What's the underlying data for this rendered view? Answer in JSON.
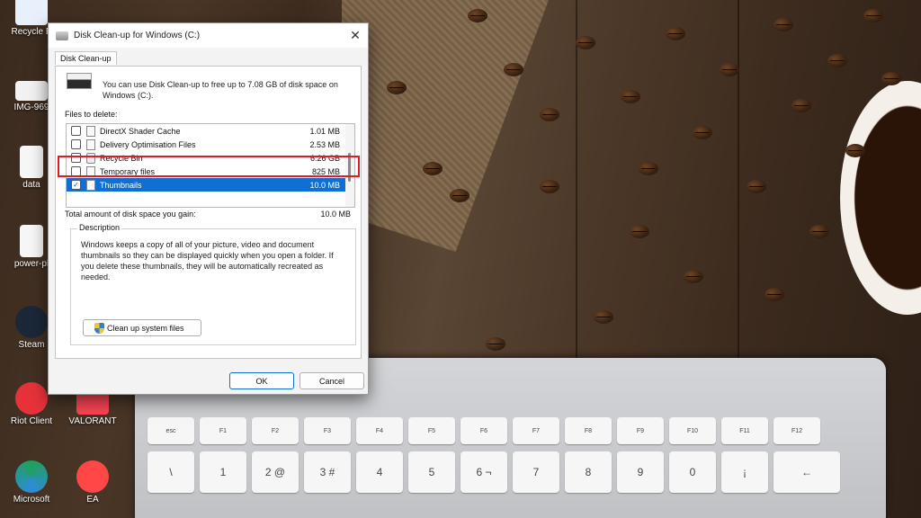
{
  "desktop": {
    "icons": [
      {
        "label": "Recycle B"
      },
      {
        "label": "IMG-969"
      },
      {
        "label": "data"
      },
      {
        "label": "power-pl"
      },
      {
        "label": "Steam"
      },
      {
        "label": "Riot Client"
      },
      {
        "label": "VALORANT"
      },
      {
        "label": "Microsoft"
      },
      {
        "label": "EA"
      }
    ]
  },
  "keyboard": {
    "fn_row": [
      "esc",
      "F1",
      "F2",
      "F3",
      "F4",
      "F5",
      "F6",
      "F7",
      "F8",
      "F9",
      "F10",
      "F11",
      "F12"
    ],
    "num_row": [
      "°",
      "!",
      "\"",
      "·",
      "$",
      "%",
      "&",
      "/",
      "(",
      ")",
      "=",
      "¿"
    ],
    "num_row_lower": [
      "\\",
      "1",
      "2 @",
      "3 #",
      "4",
      "5",
      "6 ¬",
      "7",
      "8",
      "9",
      "0",
      "¡"
    ],
    "backspace": "←"
  },
  "dialog": {
    "title": "Disk Clean-up for Windows (C:)",
    "tab": "Disk Clean-up",
    "header_text": "You can use Disk Clean-up to free up to 7.08 GB of disk space on Windows (C:).",
    "files_label": "Files to delete:",
    "files": [
      {
        "name": "DirectX Shader Cache",
        "size": "1.01 MB",
        "checked": false
      },
      {
        "name": "Delivery Optimisation Files",
        "size": "2.53 MB",
        "checked": false
      },
      {
        "name": "Recycle Bin",
        "size": "6.26 GB",
        "checked": false
      },
      {
        "name": "Temporary files",
        "size": "825 MB",
        "checked": false
      },
      {
        "name": "Thumbnails",
        "size": "10.0 MB",
        "checked": true
      }
    ],
    "total_label": "Total amount of disk space you gain:",
    "total_value": "10.0 MB",
    "description_legend": "Description",
    "description_text": "Windows keeps a copy of all of your picture, video and document thumbnails so they can be displayed quickly when you open a folder. If you delete these thumbnails, they will be automatically recreated as needed.",
    "clean_system_label": "Clean up system files",
    "ok_label": "OK",
    "cancel_label": "Cancel",
    "close_glyph": "✕"
  }
}
